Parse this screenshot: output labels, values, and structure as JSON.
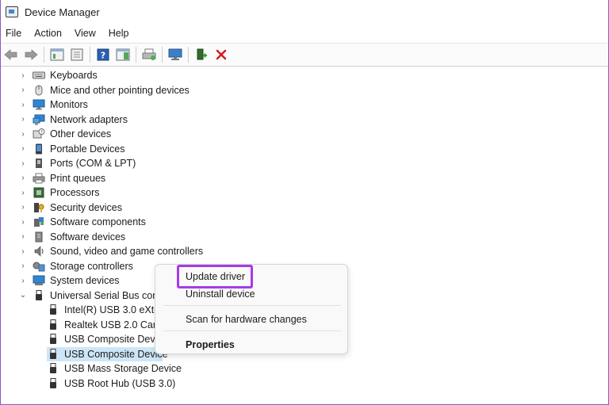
{
  "window": {
    "title": "Device Manager"
  },
  "menu": [
    "File",
    "Action",
    "View",
    "Help"
  ],
  "toolbar": {
    "buttons": [
      "back-arrow-icon",
      "forward-arrow-icon",
      "properties-icon",
      "show-hidden-icon",
      "help-icon",
      "action-pane-icon",
      "print-icon",
      "scan-hardware-icon",
      "update-driver-icon",
      "uninstall-icon"
    ]
  },
  "tree": {
    "categories": [
      {
        "label": "Keyboards",
        "icon": "keyboard-icon"
      },
      {
        "label": "Mice and other pointing devices",
        "icon": "mouse-icon"
      },
      {
        "label": "Monitors",
        "icon": "monitor-icon"
      },
      {
        "label": "Network adapters",
        "icon": "network-icon"
      },
      {
        "label": "Other devices",
        "icon": "unknown-device-icon"
      },
      {
        "label": "Portable Devices",
        "icon": "portable-icon"
      },
      {
        "label": "Ports (COM & LPT)",
        "icon": "port-icon"
      },
      {
        "label": "Print queues",
        "icon": "printer-icon"
      },
      {
        "label": "Processors",
        "icon": "processor-icon"
      },
      {
        "label": "Security devices",
        "icon": "security-icon"
      },
      {
        "label": "Software components",
        "icon": "software-component-icon"
      },
      {
        "label": "Software devices",
        "icon": "software-device-icon"
      },
      {
        "label": "Sound, video and game controllers",
        "icon": "speaker-icon"
      },
      {
        "label": "Storage controllers",
        "icon": "storage-icon"
      },
      {
        "label": "System devices",
        "icon": "system-icon"
      }
    ],
    "expanded": {
      "label": "Universal Serial Bus contr",
      "icon": "usb-icon",
      "children": [
        {
          "label": "Intel(R) USB 3.0 eXten"
        },
        {
          "label": "Realtek USB 2.0 Card"
        },
        {
          "label": "USB Composite Devic"
        },
        {
          "label": "USB Composite Device"
        },
        {
          "label": "USB Mass Storage Device"
        },
        {
          "label": "USB Root Hub (USB 3.0)"
        }
      ],
      "selected_index": 3
    }
  },
  "context_menu": {
    "items": [
      "Update driver",
      "Uninstall device",
      "Scan for hardware changes",
      "Properties"
    ],
    "highlight_color": "#a53ae8"
  }
}
